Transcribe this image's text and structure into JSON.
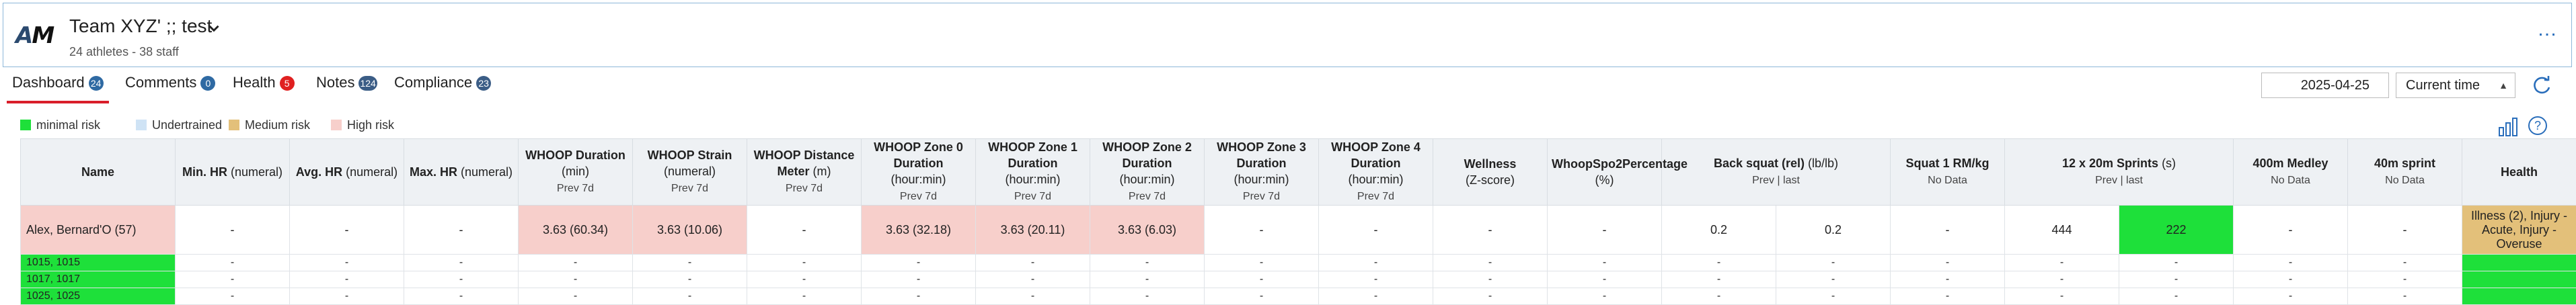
{
  "header": {
    "logo": {
      "left": "A",
      "right": "M"
    },
    "title": "Team XYZ' ;; test",
    "subtitle": "24 athletes - 38 staff",
    "more": "…"
  },
  "tabs": [
    {
      "label": "Dashboard",
      "badge": "24",
      "badge_color": "#2f6aa3"
    },
    {
      "label": "Comments",
      "badge": "0",
      "badge_color": "#2f6aa3"
    },
    {
      "label": "Health",
      "badge": "5",
      "badge_color": "#e02020"
    },
    {
      "label": "Notes",
      "badge": "124",
      "badge_color": "#3b5d86"
    },
    {
      "label": "Compliance",
      "badge": "23",
      "badge_color": "#3b5d86"
    }
  ],
  "toolbar": {
    "date": "2025-04-25",
    "time_mode": "Current time"
  },
  "legend": [
    {
      "label": "minimal risk",
      "color": "#1ee03a"
    },
    {
      "label": "Undertrained",
      "color": "#cfe3f5"
    },
    {
      "label": "Medium risk",
      "color": "#e3c07a"
    },
    {
      "label": "High risk",
      "color": "#f7cfcb"
    }
  ],
  "columns": [
    {
      "title": "Name",
      "sub": "",
      "sub2": ""
    },
    {
      "title": "Min. HR",
      "sub": "(numeral)",
      "sub2": ""
    },
    {
      "title": "Avg. HR",
      "sub": "(numeral)",
      "sub2": ""
    },
    {
      "title": "Max. HR",
      "sub": "(numeral)",
      "sub2": ""
    },
    {
      "title": "WHOOP Duration",
      "sub": "(min)",
      "sub2": "Prev 7d"
    },
    {
      "title": "WHOOP Strain",
      "sub": "(numeral)",
      "sub2": "Prev 7d"
    },
    {
      "title": "WHOOP Distance Meter",
      "sub": "(m)",
      "sub2": "Prev 7d"
    },
    {
      "title": "WHOOP Zone 0 Duration",
      "sub": "(hour:min)",
      "sub2": "Prev 7d"
    },
    {
      "title": "WHOOP Zone 1 Duration",
      "sub": "(hour:min)",
      "sub2": "Prev 7d"
    },
    {
      "title": "WHOOP Zone 2 Duration",
      "sub": "(hour:min)",
      "sub2": "Prev 7d"
    },
    {
      "title": "WHOOP Zone 3 Duration",
      "sub": "(hour:min)",
      "sub2": "Prev 7d"
    },
    {
      "title": "WHOOP Zone 4 Duration",
      "sub": "(hour:min)",
      "sub2": "Prev 7d"
    },
    {
      "title": "Wellness",
      "sub": "(Z-score)",
      "sub2": ""
    },
    {
      "title": "WhoopSpo2Percentage",
      "sub": "(%)",
      "sub2": ""
    },
    {
      "title": "Back squat (rel)",
      "sub": "(lb/lb)",
      "sub2": "Prev | last"
    },
    {
      "title": "Squat 1 RM/kg",
      "sub": "",
      "sub2": "No Data"
    },
    {
      "title": "12 x 20m Sprints",
      "sub": "(s)",
      "sub2": "Prev | last"
    },
    {
      "title": "400m Medley",
      "sub": "",
      "sub2": "No Data"
    },
    {
      "title": "40m sprint",
      "sub": "",
      "sub2": "No Data"
    },
    {
      "title": "Health",
      "sub": "",
      "sub2": ""
    }
  ],
  "rows": [
    {
      "name": "Alex, Bernard'O (57)",
      "cells": [
        "-",
        "-",
        "-",
        "3.63 (60.34)",
        "3.63 (10.06)",
        "-",
        "3.63 (32.18)",
        "3.63 (20.11)",
        "3.63 (6.03)",
        "-",
        "-",
        "-",
        "-",
        "0.2",
        "0.2",
        "-",
        "444",
        "222",
        "-",
        "-",
        "Illness (2), Injury - Acute, Injury - Overuse"
      ]
    },
    {
      "name": "1015, 1015",
      "cells": [
        "-",
        "-",
        "-",
        "-",
        "-",
        "-",
        "-",
        "-",
        "-",
        "-",
        "-",
        "-",
        "-",
        "-",
        "-",
        "-",
        "-",
        "-",
        "-",
        "-",
        ""
      ]
    },
    {
      "name": "1017, 1017",
      "cells": [
        "-",
        "-",
        "-",
        "-",
        "-",
        "-",
        "-",
        "-",
        "-",
        "-",
        "-",
        "-",
        "-",
        "-",
        "-",
        "-",
        "-",
        "-",
        "-",
        "-",
        ""
      ]
    },
    {
      "name": "1025, 1025",
      "cells": [
        "-",
        "-",
        "-",
        "-",
        "-",
        "-",
        "-",
        "-",
        "-",
        "-",
        "-",
        "-",
        "-",
        "-",
        "-",
        "-",
        "-",
        "-",
        "-",
        "-",
        ""
      ]
    }
  ]
}
